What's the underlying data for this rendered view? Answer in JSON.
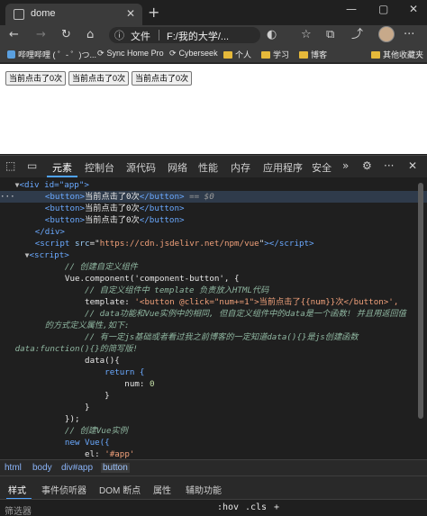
{
  "browser": {
    "tab_title": "dome",
    "tab_close": "✕",
    "new_tab": "+",
    "window_controls": [
      "—",
      "▢",
      "✕"
    ],
    "address_label": "文件",
    "address_url": "F:/我的大学/...",
    "nav_icons": [
      "back-icon",
      "forward-icon",
      "refresh-icon",
      "home-icon"
    ],
    "toolbar_icons": [
      "extension-icon",
      "favorites-icon",
      "collections-icon",
      "share-icon"
    ],
    "more": "···"
  },
  "bookmarks": [
    {
      "label": "哔哩哔哩 ( ゜- ゜)つ..."
    },
    {
      "label": "Sync Home Pro"
    },
    {
      "label": "Cyberseek"
    },
    {
      "label": "个人"
    },
    {
      "label": "学习"
    },
    {
      "label": "博客"
    },
    {
      "label": "其他收藏夹"
    }
  ],
  "page": {
    "buttons": [
      "当前点击了0次",
      "当前点击了0次",
      "当前点击了0次"
    ]
  },
  "devtools": {
    "tabs": [
      "元素",
      "控制台",
      "源代码",
      "网络",
      "性能",
      "内存",
      "应用程序",
      "安全"
    ],
    "active_tab": "元素",
    "overflow": "»",
    "code": {
      "l1_tag": "<div id=\"app\">",
      "l2_btn_open": "<button>",
      "l2_btn_text": "当前点击了0次",
      "l2_btn_close": "</button>",
      "l2_eq": " == $0",
      "l3": "当前点击了0次",
      "l4": "当前点击了0次",
      "l5": "</div>",
      "l6_src": "https://cdn.jsdelivr.net/npm/vue",
      "l7": "<script>",
      "c1": "// 创建自定义组件",
      "reg": "Vue.component('component-button', {",
      "c2": "// 自定义组件中 template 负责放入HTML代码",
      "tpl_key": "template: ",
      "tpl_val": "'<button @click=\"num+=1\">当前点击了{{num}}次</button>',",
      "c3a": "// data功能和Vue实例中的相同, 但自定义组件中的data是一个函数! 并且用返回值",
      "c3b": "的方式定义属性,如下:",
      "c4a": "// 有一定js基础或者看过我之前博客的一定知道data(){}是js创建函数",
      "c4b": "data:function(){}的简写版!",
      "data_fn": "data(){",
      "ret": "return {",
      "num_key": "num: ",
      "num_val": "0",
      "close1": "}",
      "close2": "}",
      "close3": "});",
      "c5": "// 创建Vue实例",
      "newvue": "new Vue({",
      "el_key": "el: ",
      "el_val": "'#app'"
    },
    "breadcrumbs": [
      "html",
      "body",
      "div#app",
      "button"
    ],
    "panel_tabs": [
      "样式",
      "事件侦听器",
      "DOM 断点",
      "属性",
      "辅助功能"
    ],
    "filter_placeholder": "筛选器",
    "filter_buttons": [
      ":hov",
      ".cls",
      "+"
    ]
  }
}
